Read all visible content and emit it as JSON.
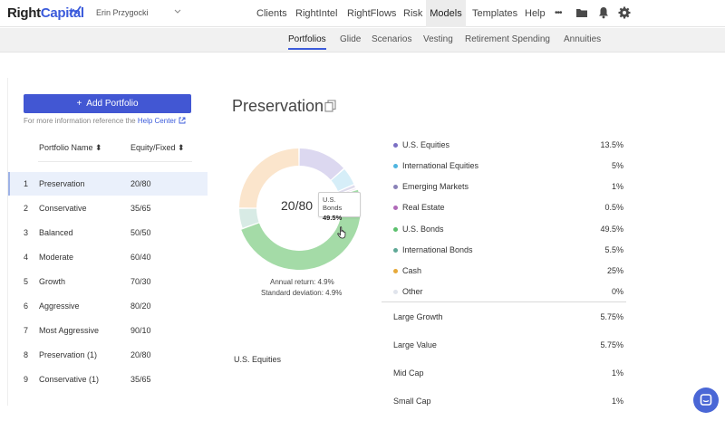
{
  "app": {
    "brand_left": "Right",
    "brand_right": "Capital",
    "user_name": "Erin Przygocki"
  },
  "nav": {
    "items": [
      {
        "label": "Clients"
      },
      {
        "label": "RightIntel"
      },
      {
        "label": "RightFlows"
      },
      {
        "label": "Risk"
      },
      {
        "label": "Models"
      },
      {
        "label": "Templates"
      },
      {
        "label": "Help"
      }
    ],
    "more_glyph": "•••"
  },
  "subtabs": [
    {
      "label": "Portfolios"
    },
    {
      "label": "Glide"
    },
    {
      "label": "Scenarios"
    },
    {
      "label": "Vesting"
    },
    {
      "label": "Retirement Spending"
    },
    {
      "label": "Annuities"
    }
  ],
  "left": {
    "add_label": "Add Portfolio",
    "add_icon": "+",
    "help_text": "For more information reference the",
    "help_link": "Help Center",
    "col_name": "Portfolio Name",
    "col_mix": "Equity/Fixed",
    "sort_glyph": "⬍",
    "rows": [
      {
        "num": "1",
        "name": "Preservation",
        "mix": "20/80"
      },
      {
        "num": "2",
        "name": "Conservative",
        "mix": "35/65"
      },
      {
        "num": "3",
        "name": "Balanced",
        "mix": "50/50"
      },
      {
        "num": "4",
        "name": "Moderate",
        "mix": "60/40"
      },
      {
        "num": "5",
        "name": "Growth",
        "mix": "70/30"
      },
      {
        "num": "6",
        "name": "Aggressive",
        "mix": "80/20"
      },
      {
        "num": "7",
        "name": "Most Aggressive",
        "mix": "90/10"
      },
      {
        "num": "8",
        "name": "Preservation (1)",
        "mix": "20/80"
      },
      {
        "num": "9",
        "name": "Conservative (1)",
        "mix": "35/65"
      }
    ]
  },
  "detail": {
    "title": "Preservation",
    "center_label": "20/80",
    "tooltip_name": "U.S. Bonds",
    "tooltip_value": "49.5%",
    "annual_return": "Annual return: 4.9%",
    "std_dev": "Standard deviation: 4.9%",
    "allocation": [
      {
        "name": "U.S. Equities",
        "pct": "13.5%",
        "value": 13.5,
        "color": "#7b6fc4",
        "soft": "#dcd8f0"
      },
      {
        "name": "International Equities",
        "pct": "5%",
        "value": 5,
        "color": "#4fb5e0",
        "soft": "#d6eef8"
      },
      {
        "name": "Emerging Markets",
        "pct": "1%",
        "value": 1,
        "color": "#8a82b8",
        "soft": "#dedbec"
      },
      {
        "name": "Real Estate",
        "pct": "0.5%",
        "value": 0.5,
        "color": "#b06ab8",
        "soft": "#ead7ec"
      },
      {
        "name": "U.S. Bonds",
        "pct": "49.5%",
        "value": 49.5,
        "color": "#5cc06e",
        "soft": "#a4dba7"
      },
      {
        "name": "International Bonds",
        "pct": "5.5%",
        "value": 5.5,
        "color": "#5fa896",
        "soft": "#d8ebe5"
      },
      {
        "name": "Cash",
        "pct": "25%",
        "value": 25,
        "color": "#e6a93a",
        "soft": "#fbe5cc"
      },
      {
        "name": "Other",
        "pct": "0%",
        "value": 0,
        "color": "#e0e4ec",
        "soft": "#eef0f4"
      }
    ],
    "breakdown_group": "U.S. Equities",
    "breakdown": [
      {
        "name": "Large Growth",
        "pct": "5.75%"
      },
      {
        "name": "Large Value",
        "pct": "5.75%"
      },
      {
        "name": "Mid Cap",
        "pct": "1%"
      },
      {
        "name": "Small Cap",
        "pct": "1%"
      }
    ]
  }
}
